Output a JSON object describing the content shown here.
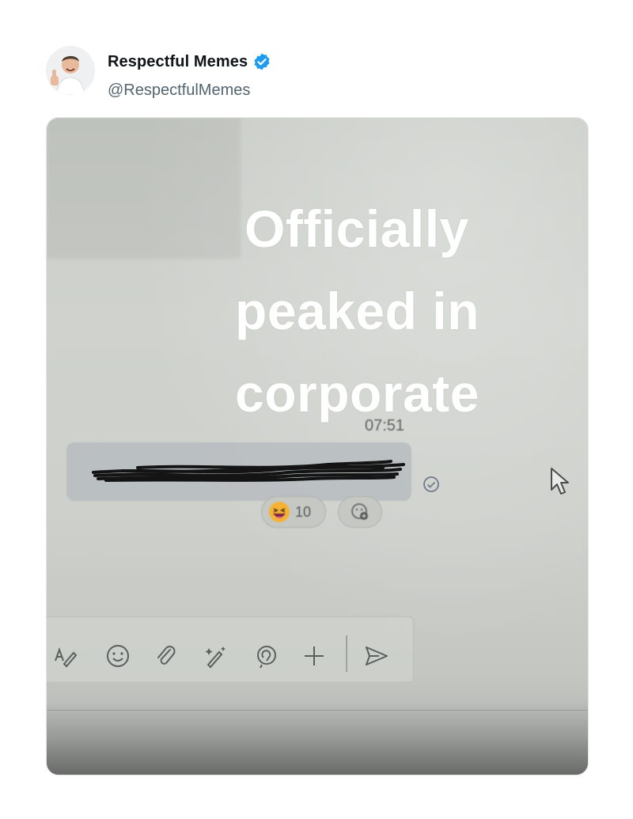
{
  "tweet": {
    "display_name": "Respectful Memes",
    "handle": "@RespectfulMemes",
    "verified": true,
    "avatar_icon": "person-thumbs-up-avatar"
  },
  "photo": {
    "caption_lines": [
      "Officially",
      "peaked in",
      "corporate"
    ],
    "chat": {
      "timestamp": "07:51",
      "message_text_redacted": true,
      "reaction": {
        "emoji": "grinning-squinting-face",
        "count": "10"
      },
      "status_icon": "seen-check-icon"
    },
    "composer_tools": [
      "format-icon",
      "emoji-icon",
      "attach-icon",
      "magic-wand-icon",
      "loop-icon",
      "plus-icon",
      "send-icon"
    ]
  },
  "colors": {
    "verified_blue": "#1d9bf0",
    "handle_gray": "#536471",
    "caption_white": "#ffffff",
    "reaction_emoji_yellow": "#f5b335"
  }
}
